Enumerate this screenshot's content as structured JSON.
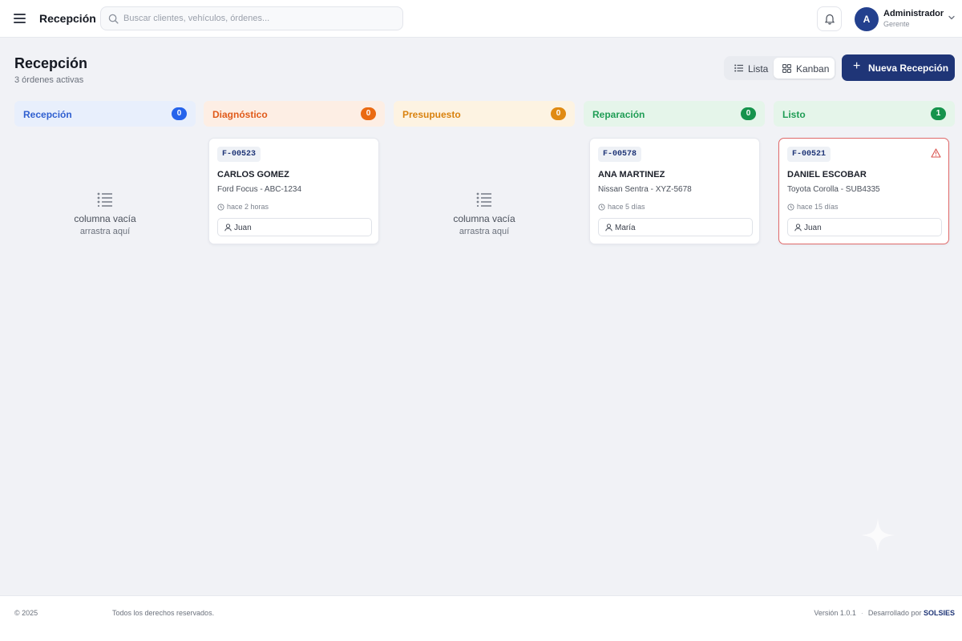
{
  "header": {
    "title": "Recepción",
    "search_placeholder": "Buscar clientes, vehículos, órdenes...",
    "user": {
      "initial": "A",
      "name": "Administrador",
      "role": "Gerente"
    }
  },
  "page": {
    "title": "Recepción",
    "subtitle": "3 órdenes activas",
    "views": {
      "list": "Lista",
      "kanban": "Kanban",
      "active": "kanban"
    },
    "new_button": "Nueva Recepción"
  },
  "columns": [
    {
      "name": "Recepción",
      "count": "0",
      "color": "#2f5fd0",
      "bg": "#e8effc",
      "badge": "#2563eb"
    },
    {
      "name": "Diagnóstico",
      "count": "0",
      "color": "#e05a1a",
      "bg": "#fdeee4",
      "badge": "#ea6a12"
    },
    {
      "name": "Presupuesto",
      "count": "0",
      "color": "#d9820f",
      "bg": "#fdf3e2",
      "badge": "#e08a12"
    },
    {
      "name": "Reparación",
      "count": "0",
      "color": "#1f9d55",
      "bg": "#e5f5ea",
      "badge": "#16934c"
    },
    {
      "name": "Listo",
      "count": "1",
      "color": "#1f9d55",
      "bg": "#e5f5ea",
      "badge": "#16934c"
    }
  ],
  "empty_state": {
    "line1": "columna vacía",
    "line2": "arrastra aquí"
  },
  "cards": [
    {
      "code": "F-00523",
      "client": "CARLOS GOMEZ",
      "vehicle": "Ford Focus - ABC-1234",
      "time": "hace 2 horas",
      "assignee": "Juan",
      "alert": false
    },
    {
      "code": "F-00578",
      "client": "ANA MARTINEZ",
      "vehicle": "Nissan Sentra - XYZ-5678",
      "time": "hace 5 días",
      "assignee": "María",
      "alert": false
    },
    {
      "code": "F-00521",
      "client": "DANIEL ESCOBAR",
      "vehicle": "Toyota Corolla - SUB4335",
      "time": "hace 15 días",
      "assignee": "Juan",
      "alert": true
    }
  ],
  "footer": {
    "copyright": "© 2025",
    "rights": "Todos los derechos reservados.",
    "version": "Versión 1.0.1",
    "developed_by": "Desarrollado por",
    "brand": "SOLSIES"
  }
}
